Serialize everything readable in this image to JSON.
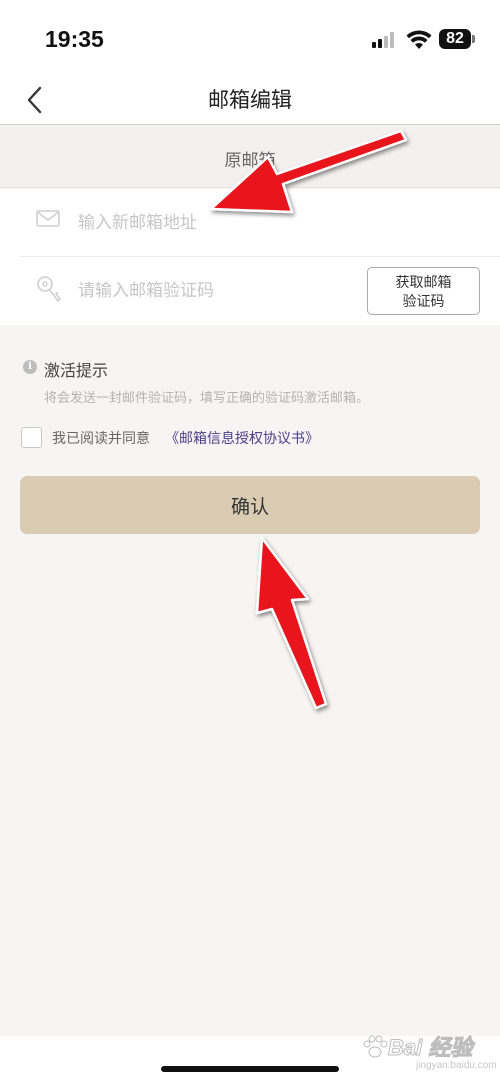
{
  "status_bar": {
    "time": "19:35",
    "battery": "82",
    "signal_icon": "cellular-signal-icon",
    "wifi_icon": "wifi-icon"
  },
  "nav": {
    "back_icon": "chevron-left-icon",
    "title": "邮箱编辑"
  },
  "original_email": {
    "label": "原邮箱"
  },
  "form": {
    "email": {
      "icon": "envelope-icon",
      "placeholder": "输入新邮箱地址",
      "value": ""
    },
    "code": {
      "icon": "key-icon",
      "placeholder": "请输入邮箱验证码",
      "value": "",
      "button_line1": "获取邮箱",
      "button_line2": "验证码"
    }
  },
  "hint": {
    "icon": "info-icon",
    "title": "激活提示",
    "description": "将会发送一封邮件验证码，填写正确的验证码激活邮箱。"
  },
  "agreement": {
    "checked": false,
    "text": "我已阅读并同意",
    "link": "《邮箱信息授权协议书》"
  },
  "confirm_button": {
    "label": "确认",
    "color": "#d9ccb3"
  },
  "annotations": {
    "arrow_color": "#e8151b"
  },
  "watermark": {
    "logo": "Bai 经验",
    "url": "jingyan.baidu.com"
  }
}
